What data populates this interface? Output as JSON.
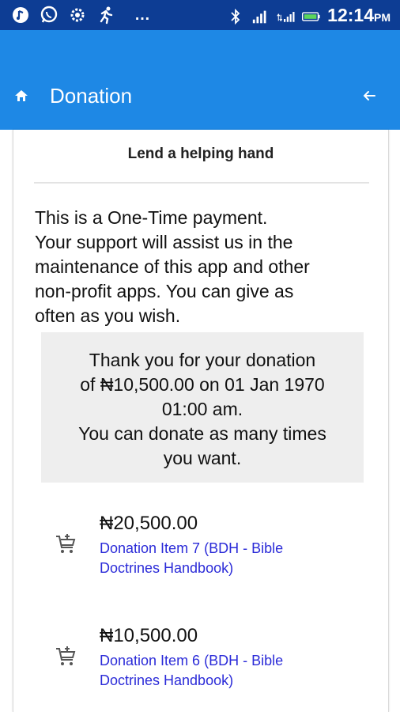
{
  "status_bar": {
    "time": "12:14",
    "ampm": "PM",
    "more": "…",
    "icons": [
      "vpn-icon",
      "whatsapp-icon",
      "settings-icon",
      "running-icon",
      "bluetooth-icon",
      "signal-icon",
      "signal-icon-2",
      "battery-icon"
    ]
  },
  "app_bar": {
    "title": "Donation",
    "color": "#1e88e5",
    "left_icon": "home-icon",
    "right_icon": "back-arrow-icon"
  },
  "card": {
    "title": "Lend a helping hand",
    "intro_lines": [
      "This is a One-Time payment.",
      "Your support will assist us in the",
      "maintenance of this app and other",
      "non-profit apps. You can give as",
      "often as you wish."
    ],
    "thanks_lines": [
      "Thank you for your donation",
      "of ₦10,500.00 on 01 Jan 1970",
      "01:00 am.",
      "You can donate as many times",
      "you want."
    ]
  },
  "items": [
    {
      "price": "₦20,500.00",
      "name_lines": [
        "Donation Item 7 (BDH - Bible",
        "Doctrines Handbook)"
      ],
      "icon": "add-to-cart-icon"
    },
    {
      "price": "₦10,500.00",
      "name_lines": [
        "Donation Item 6 (BDH - Bible",
        "Doctrines Handbook)"
      ],
      "icon": "add-to-cart-icon"
    }
  ]
}
